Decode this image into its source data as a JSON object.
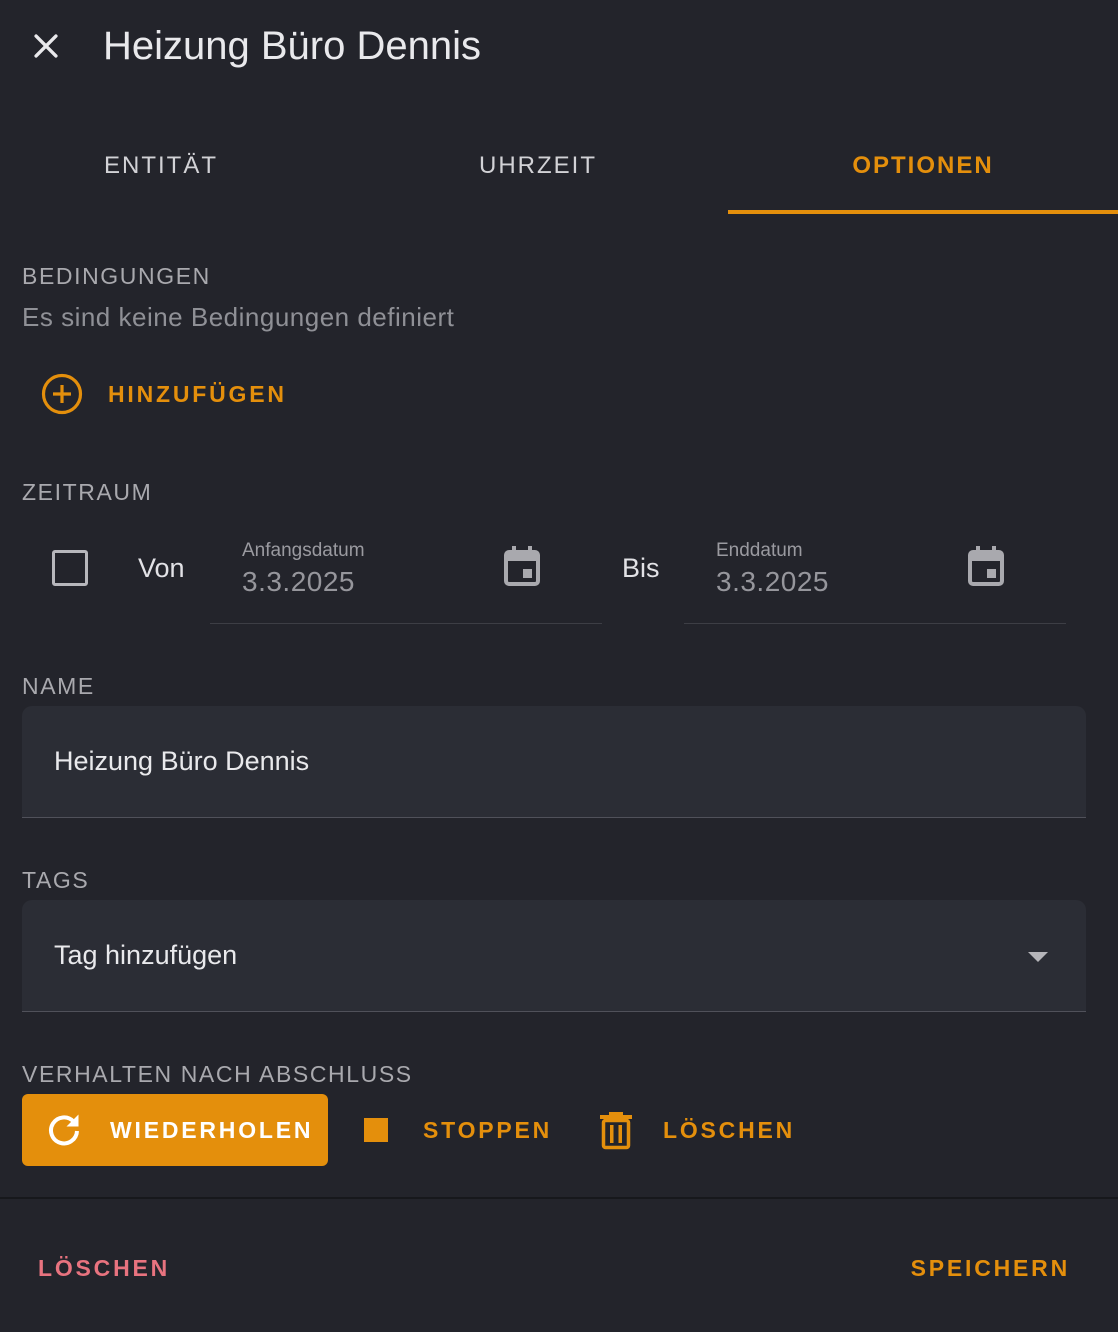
{
  "header": {
    "title": "Heizung Büro Dennis"
  },
  "tabs": [
    {
      "label": "ENTITÄT",
      "active": false
    },
    {
      "label": "UHRZEIT",
      "active": false
    },
    {
      "label": "OPTIONEN",
      "active": true
    }
  ],
  "conditions": {
    "heading": "BEDINGUNGEN",
    "empty_text": "Es sind keine Bedingungen definiert",
    "add_label": "HINZUFÜGEN"
  },
  "period": {
    "heading": "ZEITRAUM",
    "enabled": false,
    "from_label": "Von",
    "start_caption": "Anfangsdatum",
    "start_value": "3.3.2025",
    "to_label": "Bis",
    "end_caption": "Enddatum",
    "end_value": "3.3.2025"
  },
  "name": {
    "heading": "NAME",
    "value": "Heizung Büro Dennis"
  },
  "tags": {
    "heading": "TAGS",
    "placeholder": "Tag hinzufügen"
  },
  "after_completion": {
    "heading": "VERHALTEN NACH ABSCHLUSS",
    "options": [
      {
        "label": "WIEDERHOLEN",
        "icon": "repeat-icon",
        "selected": true
      },
      {
        "label": "STOPPEN",
        "icon": "stop-icon",
        "selected": false
      },
      {
        "label": "LÖSCHEN",
        "icon": "trash-icon",
        "selected": false
      }
    ]
  },
  "footer": {
    "delete_label": "LÖSCHEN",
    "save_label": "SPEICHERN"
  },
  "colors": {
    "background": "#23242b",
    "accent": "#e48f0c",
    "danger": "#e8737f",
    "field": "#2b2d35"
  }
}
